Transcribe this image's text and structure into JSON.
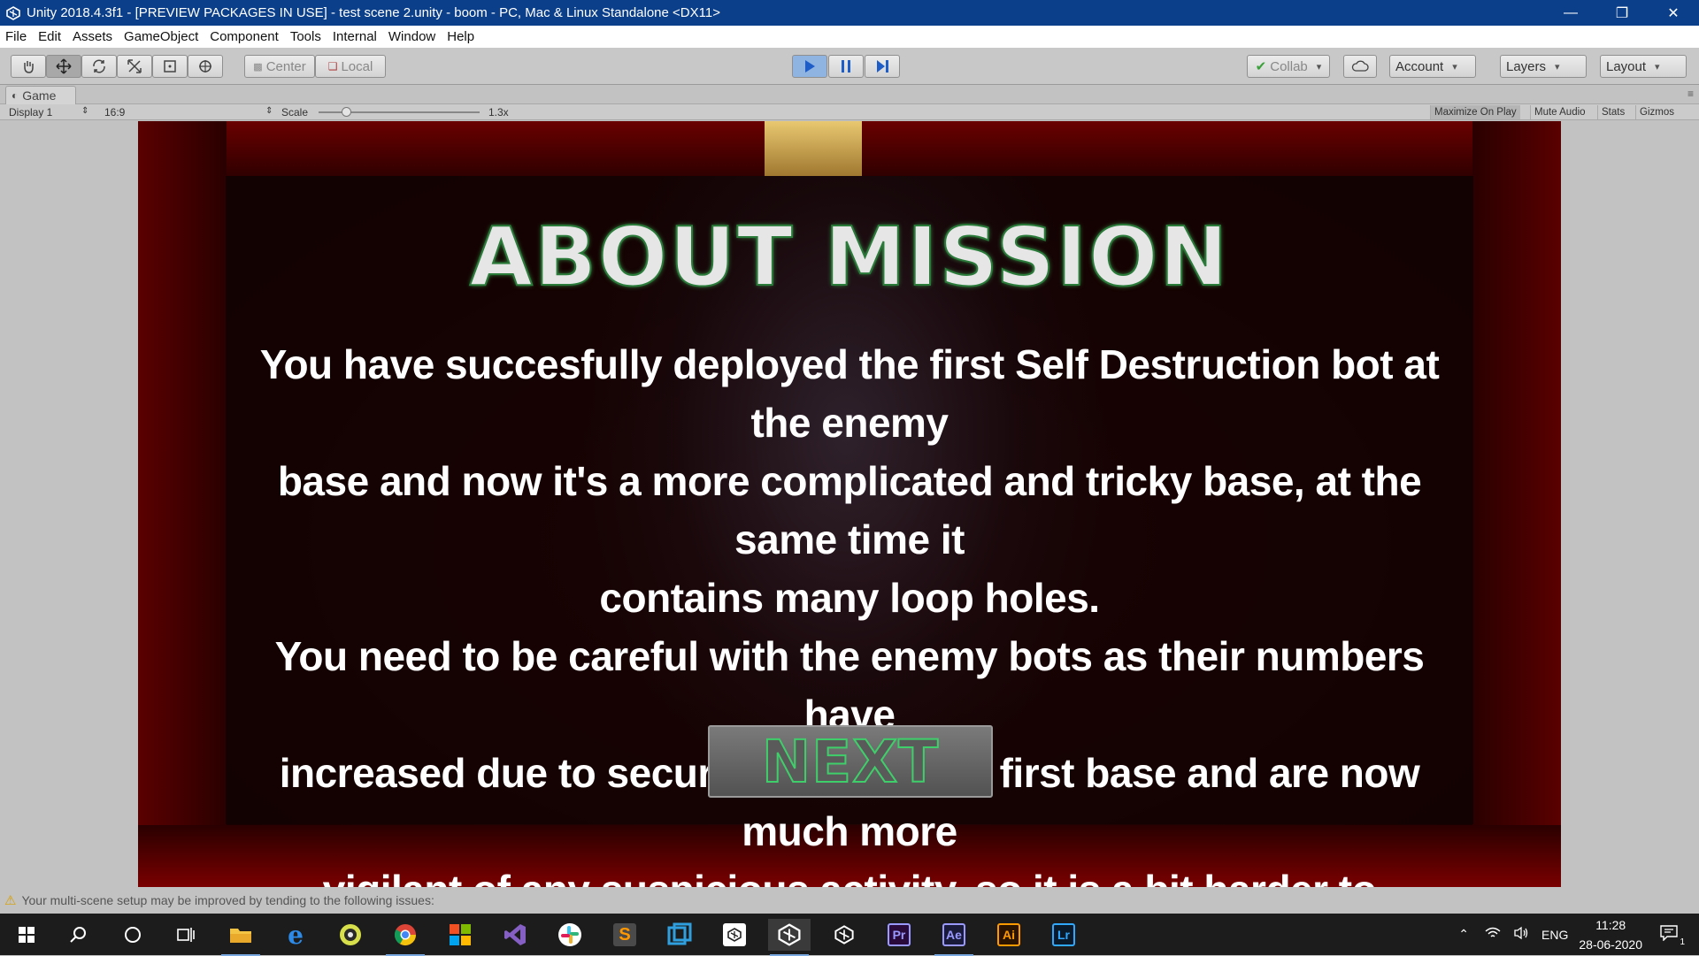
{
  "window": {
    "title": "Unity 2018.4.3f1 - [PREVIEW PACKAGES IN USE] - test scene 2.unity - boom - PC, Mac & Linux Standalone <DX11>",
    "controls": [
      "minimize-icon",
      "restore-icon",
      "close-icon"
    ]
  },
  "menu": [
    "File",
    "Edit",
    "Assets",
    "GameObject",
    "Component",
    "Tools",
    "Internal",
    "Window",
    "Help"
  ],
  "toolbar": {
    "tools": [
      "hand-tool-icon",
      "move-tool-icon",
      "rotate-tool-icon",
      "scale-tool-icon",
      "rect-tool-icon",
      "transform-tool-icon"
    ],
    "pivot_label": "Center",
    "space_label": "Local",
    "play_controls": [
      "play-icon",
      "pause-icon",
      "step-icon"
    ],
    "collab_label": "Collab",
    "account_label": "Account",
    "layers_label": "Layers",
    "layout_label": "Layout"
  },
  "game_view": {
    "tab_label": "Game",
    "display_label": "Display 1",
    "aspect_label": "16:9",
    "scale_label": "Scale",
    "scale_value": "1.3x",
    "scale_slider_fraction": 0.15,
    "maximize_label": "Maximize On Play",
    "mute_label": "Mute Audio",
    "stats_label": "Stats",
    "gizmos_label": "Gizmos"
  },
  "game": {
    "title": "ABOUT MISSION",
    "body_lines": [
      "You have succesfully deployed the first Self Destruction bot at the enemy",
      "base and now it's a more complicated and tricky base, at the same time it",
      "contains many loop holes.",
      "You need to be careful with the enemy bots as their numbers have",
      "increased due to security lapse in the first base and are now much more",
      "vigilant of any suspicious activity, so it is a bit harder to escape."
    ],
    "next_label": "NEXT"
  },
  "status": {
    "message": "Your multi-scene setup may be improved by tending to the following issues:"
  },
  "taskbar": {
    "apps": [
      "windows-start-icon",
      "search-icon",
      "cortana-icon",
      "task-view-icon",
      "file-explorer-icon",
      "edge-icon",
      "app-icon",
      "chrome-icon",
      "store-icon",
      "visual-studio-icon",
      "slack-icon",
      "sublime-icon",
      "app-icon",
      "unity-hub-icon",
      "unity-icon",
      "unity-icon",
      "premiere-icon",
      "after-effects-icon",
      "illustrator-icon",
      "lightroom-icon"
    ],
    "pr_label": "Pr",
    "ae_label": "Ae",
    "ai_label": "Ai",
    "lr_label": "Lr",
    "language": "ENG",
    "time": "11:28",
    "date": "28-06-2020",
    "notification_count": "1"
  }
}
